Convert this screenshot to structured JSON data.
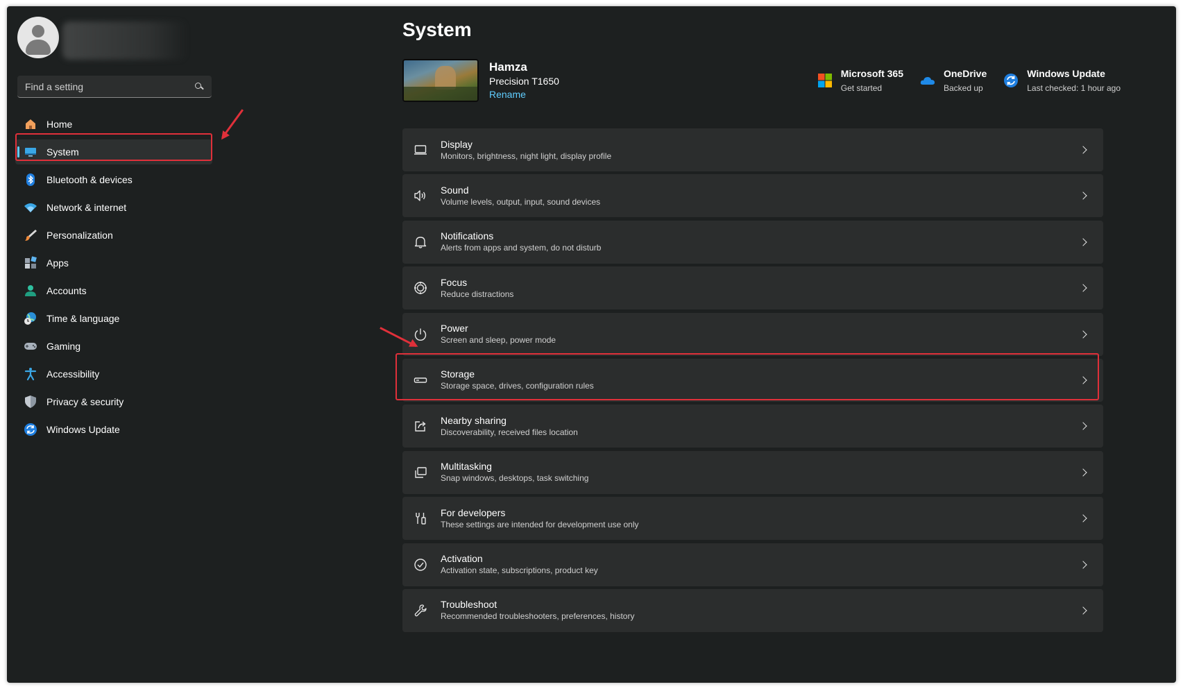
{
  "search": {
    "placeholder": "Find a setting"
  },
  "sidebar": {
    "items": [
      {
        "label": "Home",
        "icon": "home-icon"
      },
      {
        "label": "System",
        "icon": "system-icon",
        "active": true
      },
      {
        "label": "Bluetooth & devices",
        "icon": "bluetooth-icon"
      },
      {
        "label": "Network & internet",
        "icon": "wifi-icon"
      },
      {
        "label": "Personalization",
        "icon": "brush-icon"
      },
      {
        "label": "Apps",
        "icon": "apps-icon"
      },
      {
        "label": "Accounts",
        "icon": "accounts-icon"
      },
      {
        "label": "Time & language",
        "icon": "globe-clock-icon"
      },
      {
        "label": "Gaming",
        "icon": "gamepad-icon"
      },
      {
        "label": "Accessibility",
        "icon": "accessibility-icon"
      },
      {
        "label": "Privacy & security",
        "icon": "shield-icon"
      },
      {
        "label": "Windows Update",
        "icon": "update-icon"
      }
    ]
  },
  "main": {
    "title": "System",
    "device": {
      "name": "Hamza",
      "model": "Precision T1650",
      "rename": "Rename"
    },
    "services": [
      {
        "title": "Microsoft 365",
        "sub": "Get started",
        "icon": "microsoft-365-icon"
      },
      {
        "title": "OneDrive",
        "sub": "Backed up",
        "icon": "onedrive-cloud-icon"
      },
      {
        "title": "Windows Update",
        "sub": "Last checked: 1 hour ago",
        "icon": "windows-update-icon"
      }
    ],
    "settings": [
      {
        "title": "Display",
        "sub": "Monitors, brightness, night light, display profile",
        "icon": "display-icon"
      },
      {
        "title": "Sound",
        "sub": "Volume levels, output, input, sound devices",
        "icon": "speaker-icon"
      },
      {
        "title": "Notifications",
        "sub": "Alerts from apps and system, do not disturb",
        "icon": "bell-icon"
      },
      {
        "title": "Focus",
        "sub": "Reduce distractions",
        "icon": "focus-icon"
      },
      {
        "title": "Power",
        "sub": "Screen and sleep, power mode",
        "icon": "power-icon"
      },
      {
        "title": "Storage",
        "sub": "Storage space, drives, configuration rules",
        "icon": "storage-drive-icon"
      },
      {
        "title": "Nearby sharing",
        "sub": "Discoverability, received files location",
        "icon": "share-icon"
      },
      {
        "title": "Multitasking",
        "sub": "Snap windows, desktops, task switching",
        "icon": "multitasking-icon"
      },
      {
        "title": "For developers",
        "sub": "These settings are intended for development use only",
        "icon": "developer-tools-icon"
      },
      {
        "title": "Activation",
        "sub": "Activation state, subscriptions, product key",
        "icon": "check-circle-icon"
      },
      {
        "title": "Troubleshoot",
        "sub": "Recommended troubleshooters, preferences, history",
        "icon": "wrench-icon"
      }
    ]
  },
  "colors": {
    "accent": "#60cdff",
    "highlight": "#e0303a",
    "background": "#1d2020",
    "card": "#2b2d2d"
  }
}
